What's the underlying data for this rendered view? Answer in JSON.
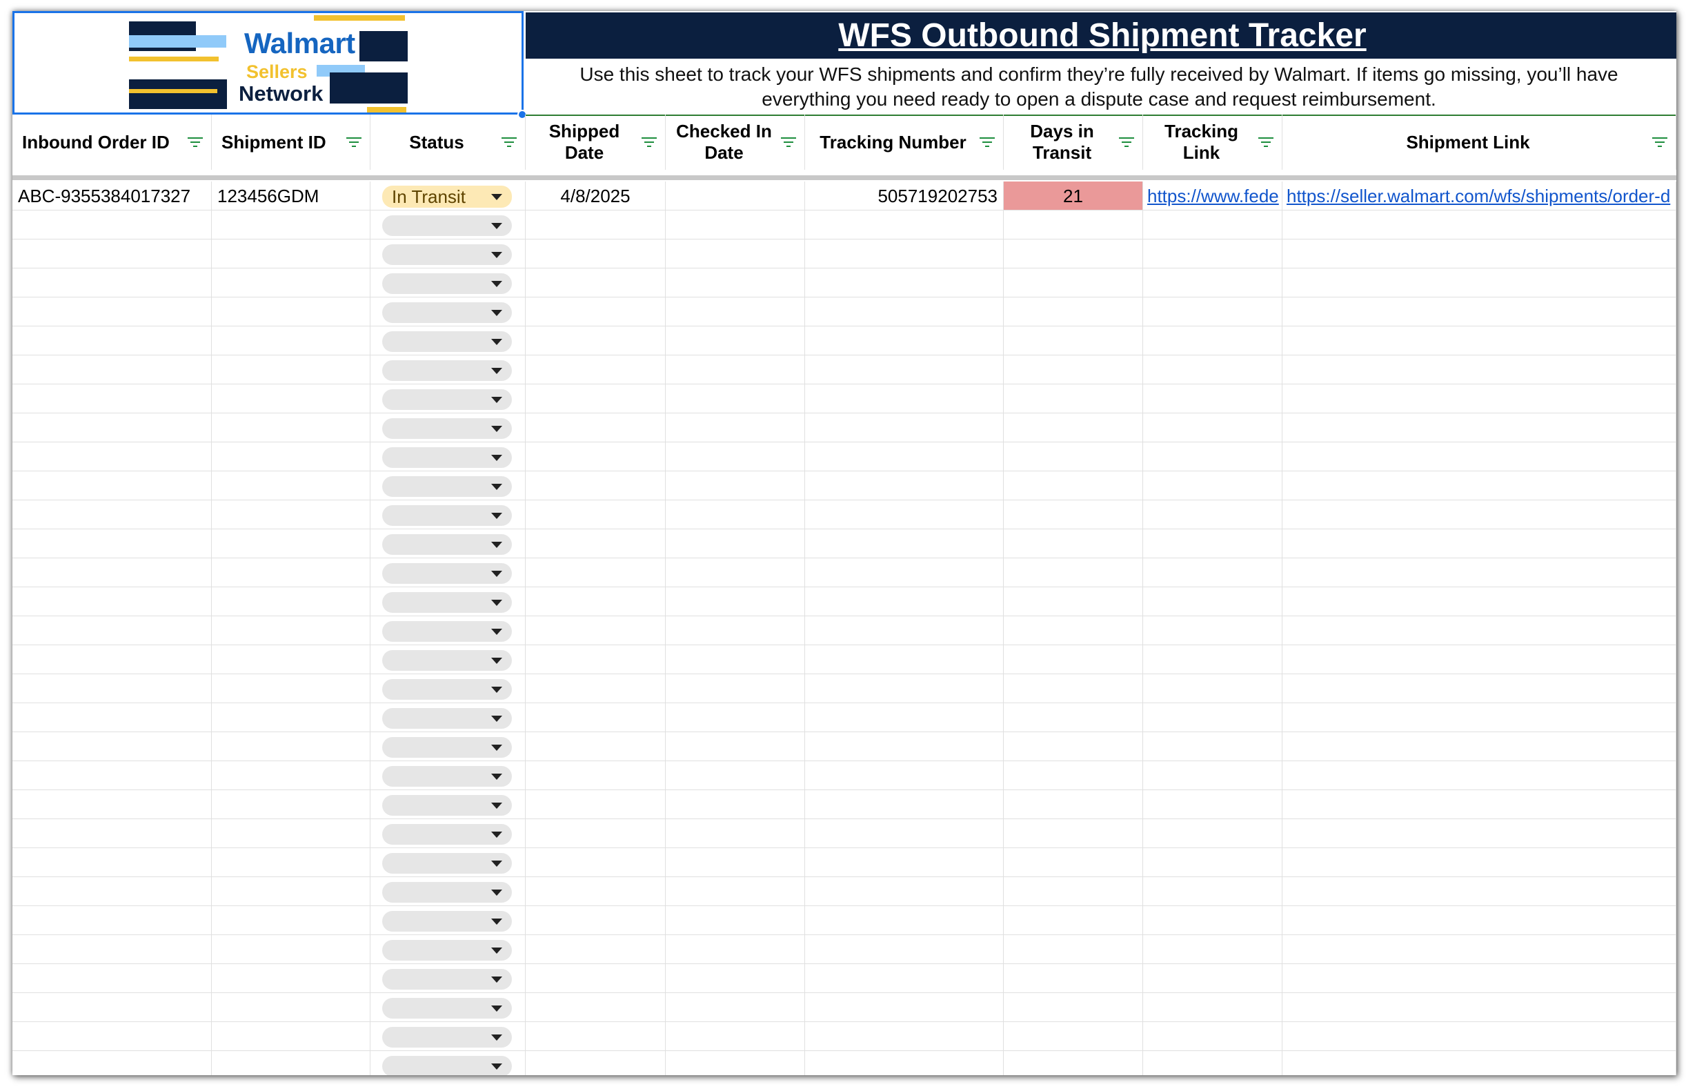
{
  "logo": {
    "line1": "Walmart",
    "line2": "Sellers",
    "line3": "Network"
  },
  "title": "WFS Outbound Shipment Tracker",
  "subtitle": "Use this sheet to track your WFS shipments and confirm they’re fully received by Walmart. If items go missing, you’ll have everything you need ready to open a dispute case and request reimbursement.",
  "columns": [
    {
      "key": "inbound_order_id",
      "label": "Inbound Order ID"
    },
    {
      "key": "shipment_id",
      "label": "Shipment ID"
    },
    {
      "key": "status",
      "label": "Status"
    },
    {
      "key": "shipped_date",
      "label": "Shipped Date"
    },
    {
      "key": "checked_in_date",
      "label": "Checked In Date"
    },
    {
      "key": "tracking_number",
      "label": "Tracking Number"
    },
    {
      "key": "days_in_transit",
      "label": "Days in Transit"
    },
    {
      "key": "tracking_link",
      "label": "Tracking Link"
    },
    {
      "key": "shipment_link",
      "label": "Shipment Link"
    }
  ],
  "rows": [
    {
      "inbound_order_id": "ABC-9355384017327",
      "shipment_id": "123456GDM",
      "status": "In Transit",
      "shipped_date": "4/8/2025",
      "checked_in_date": "",
      "tracking_number": "505719202753",
      "days_in_transit": "21",
      "tracking_link": "https://www.fede",
      "shipment_link": "https://seller.walmart.com/wfs/shipments/order-d"
    }
  ],
  "empty_row_count": 30,
  "colors": {
    "title_bg": "#0b1f3f",
    "logo_navy": "#0b1f3f",
    "logo_blue": "#1565c0",
    "logo_light_blue": "#90caf9",
    "logo_yellow": "#f2c12e",
    "status_in_transit_bg": "#fde9b5",
    "days_alert_bg": "#ea9999",
    "filter_icon": "#1e8e3e",
    "link": "#1155cc",
    "selection": "#1a73e8"
  },
  "icons": {
    "filter": "filter-icon",
    "dropdown": "chevron-down-icon"
  }
}
